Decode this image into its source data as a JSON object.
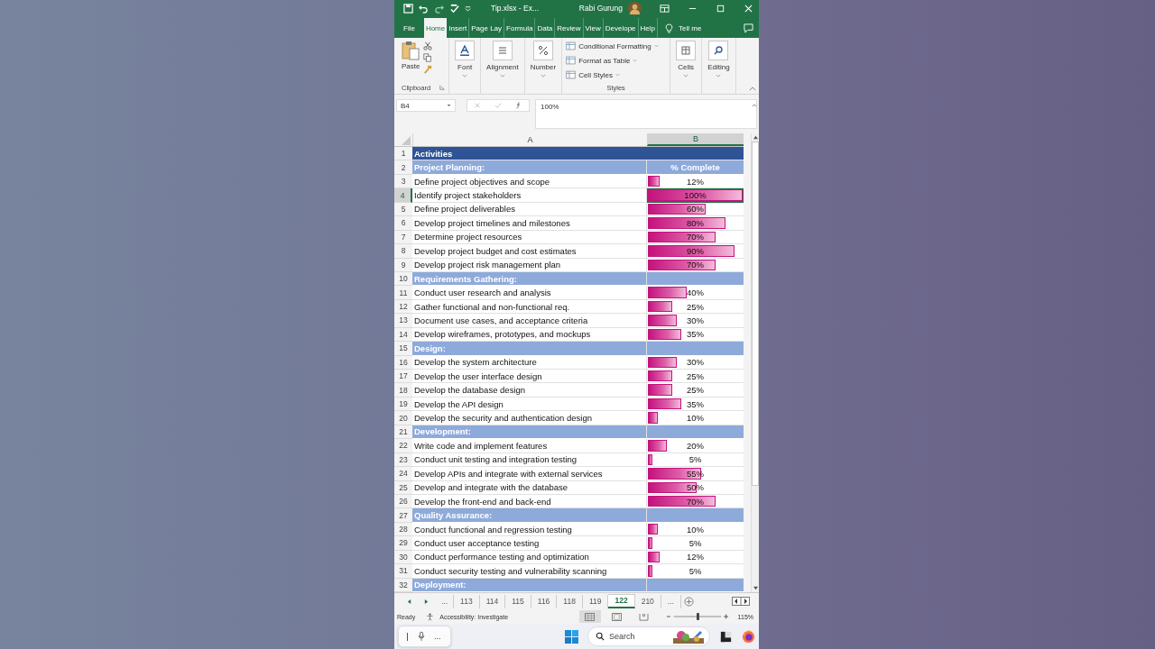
{
  "window": {
    "title": "Tip.xlsx  -  Ex...",
    "user": "Rabi Gurung"
  },
  "ribbon_tabs": [
    {
      "label": "File",
      "selected": false
    },
    {
      "label": "Home",
      "selected": true
    },
    {
      "label": "Insert",
      "selected": false
    },
    {
      "label": "Page Lay",
      "selected": false
    },
    {
      "label": "Formula",
      "selected": false
    },
    {
      "label": "Data",
      "selected": false
    },
    {
      "label": "Review",
      "selected": false
    },
    {
      "label": "View",
      "selected": false
    },
    {
      "label": "Develope",
      "selected": false
    },
    {
      "label": "Help",
      "selected": false
    }
  ],
  "tell_me": "Tell me",
  "ribbon": {
    "paste": "Paste",
    "clipboard": "Clipboard",
    "groups": [
      {
        "label": "Font",
        "kind": "font"
      },
      {
        "label": "Alignment",
        "kind": "align"
      },
      {
        "label": "Number",
        "kind": "number"
      }
    ],
    "styles": [
      "Conditional Formatting",
      "Format as Table",
      "Cell Styles"
    ],
    "styles_label": "Styles",
    "right_groups": [
      {
        "label": "Cells",
        "kind": "cells"
      },
      {
        "label": "Editing",
        "kind": "editing"
      }
    ]
  },
  "formula_bar": {
    "name_box": "B4",
    "value": "100%"
  },
  "columns": [
    {
      "label": "A",
      "selected": false
    },
    {
      "label": "B",
      "selected": true
    }
  ],
  "rows": [
    {
      "num": "1",
      "kind": "title",
      "a": "Activities",
      "selected": false
    },
    {
      "num": "2",
      "kind": "section",
      "a": "Project Planning:",
      "b": "% Complete",
      "selected": false
    },
    {
      "num": "3",
      "kind": "task",
      "a": "Define project objectives and scope",
      "b": "12%",
      "level": 0.12,
      "selected": false
    },
    {
      "num": "4",
      "kind": "task",
      "a": "Identify project stakeholders",
      "b": "100%",
      "level": 1,
      "selected": true
    },
    {
      "num": "5",
      "kind": "task",
      "a": "Define project deliverables",
      "b": "60%",
      "level": 0.6,
      "selected": false
    },
    {
      "num": "6",
      "kind": "task",
      "a": "Develop project timelines and milestones",
      "b": "80%",
      "level": 0.8,
      "selected": false
    },
    {
      "num": "7",
      "kind": "task",
      "a": "Determine project resources",
      "b": "70%",
      "level": 0.7,
      "selected": false
    },
    {
      "num": "8",
      "kind": "task",
      "a": "Develop project budget and cost estimates",
      "b": "90%",
      "level": 0.9,
      "selected": false
    },
    {
      "num": "9",
      "kind": "task",
      "a": "Develop project risk management plan",
      "b": "70%",
      "level": 0.7,
      "selected": false
    },
    {
      "num": "10",
      "kind": "section",
      "a": "Requirements Gathering:",
      "selected": false
    },
    {
      "num": "11",
      "kind": "task",
      "a": "Conduct user research and analysis",
      "b": "40%",
      "level": 0.4,
      "selected": false
    },
    {
      "num": "12",
      "kind": "task",
      "a": "Gather functional and non-functional req.",
      "b": "25%",
      "level": 0.25,
      "selected": false
    },
    {
      "num": "13",
      "kind": "task",
      "a": "Document use cases, and acceptance criteria",
      "b": "30%",
      "level": 0.3,
      "selected": false
    },
    {
      "num": "14",
      "kind": "task",
      "a": "Develop wireframes, prototypes, and mockups",
      "b": "35%",
      "level": 0.35,
      "selected": false
    },
    {
      "num": "15",
      "kind": "section",
      "a": "Design:",
      "selected": false
    },
    {
      "num": "16",
      "kind": "task",
      "a": "Develop the system architecture",
      "b": "30%",
      "level": 0.3,
      "selected": false
    },
    {
      "num": "17",
      "kind": "task",
      "a": "Develop the user interface design",
      "b": "25%",
      "level": 0.25,
      "selected": false
    },
    {
      "num": "18",
      "kind": "task",
      "a": "Develop the database design",
      "b": "25%",
      "level": 0.25,
      "selected": false
    },
    {
      "num": "19",
      "kind": "task",
      "a": "Develop the API design",
      "b": "35%",
      "level": 0.35,
      "selected": false
    },
    {
      "num": "20",
      "kind": "task",
      "a": "Develop the security and authentication design",
      "b": "10%",
      "level": 0.1,
      "selected": false
    },
    {
      "num": "21",
      "kind": "section",
      "a": "Development:",
      "selected": false
    },
    {
      "num": "22",
      "kind": "task",
      "a": "Write code and implement features",
      "b": "20%",
      "level": 0.2,
      "selected": false
    },
    {
      "num": "23",
      "kind": "task",
      "a": "Conduct unit testing and integration testing",
      "b": "5%",
      "level": 0.05,
      "selected": false
    },
    {
      "num": "24",
      "kind": "task",
      "a": "Develop APIs and integrate with external services",
      "b": "55%",
      "level": 0.55,
      "selected": false
    },
    {
      "num": "25",
      "kind": "task",
      "a": "Develop and integrate with the database",
      "b": "50%",
      "level": 0.5,
      "selected": false
    },
    {
      "num": "26",
      "kind": "task",
      "a": "Develop the front-end and back-end",
      "b": "70%",
      "level": 0.7,
      "selected": false
    },
    {
      "num": "27",
      "kind": "section",
      "a": "Quality Assurance:",
      "selected": false
    },
    {
      "num": "28",
      "kind": "task",
      "a": "Conduct functional and regression testing",
      "b": "10%",
      "level": 0.1,
      "selected": false
    },
    {
      "num": "29",
      "kind": "task",
      "a": "Conduct user acceptance testing",
      "b": "5%",
      "level": 0.05,
      "selected": false
    },
    {
      "num": "30",
      "kind": "task",
      "a": "Conduct performance testing and optimization",
      "b": "12%",
      "level": 0.12,
      "selected": false
    },
    {
      "num": "31",
      "kind": "task",
      "a": "Conduct security testing and vulnerability scanning",
      "b": "5%",
      "level": 0.05,
      "selected": false
    },
    {
      "num": "32",
      "kind": "section",
      "a": "Deployment:",
      "selected": false
    }
  ],
  "sheet_tabs": [
    {
      "label": "...",
      "selected": false
    },
    {
      "label": "113",
      "selected": false
    },
    {
      "label": "114",
      "selected": false
    },
    {
      "label": "115",
      "selected": false
    },
    {
      "label": "116",
      "selected": false
    },
    {
      "label": "118",
      "selected": false
    },
    {
      "label": "119",
      "selected": false
    },
    {
      "label": "122",
      "selected": true
    },
    {
      "label": "210",
      "selected": false
    },
    {
      "label": "...",
      "selected": false
    }
  ],
  "status_bar": {
    "ready": "Ready",
    "accessibility": "Accessibility: Investigate",
    "zoom": "115%",
    "zoom_slider": {
      "level": 0.5
    }
  },
  "dictation": {
    "more": "..."
  },
  "taskbar": {
    "search_placeholder": "Search"
  }
}
